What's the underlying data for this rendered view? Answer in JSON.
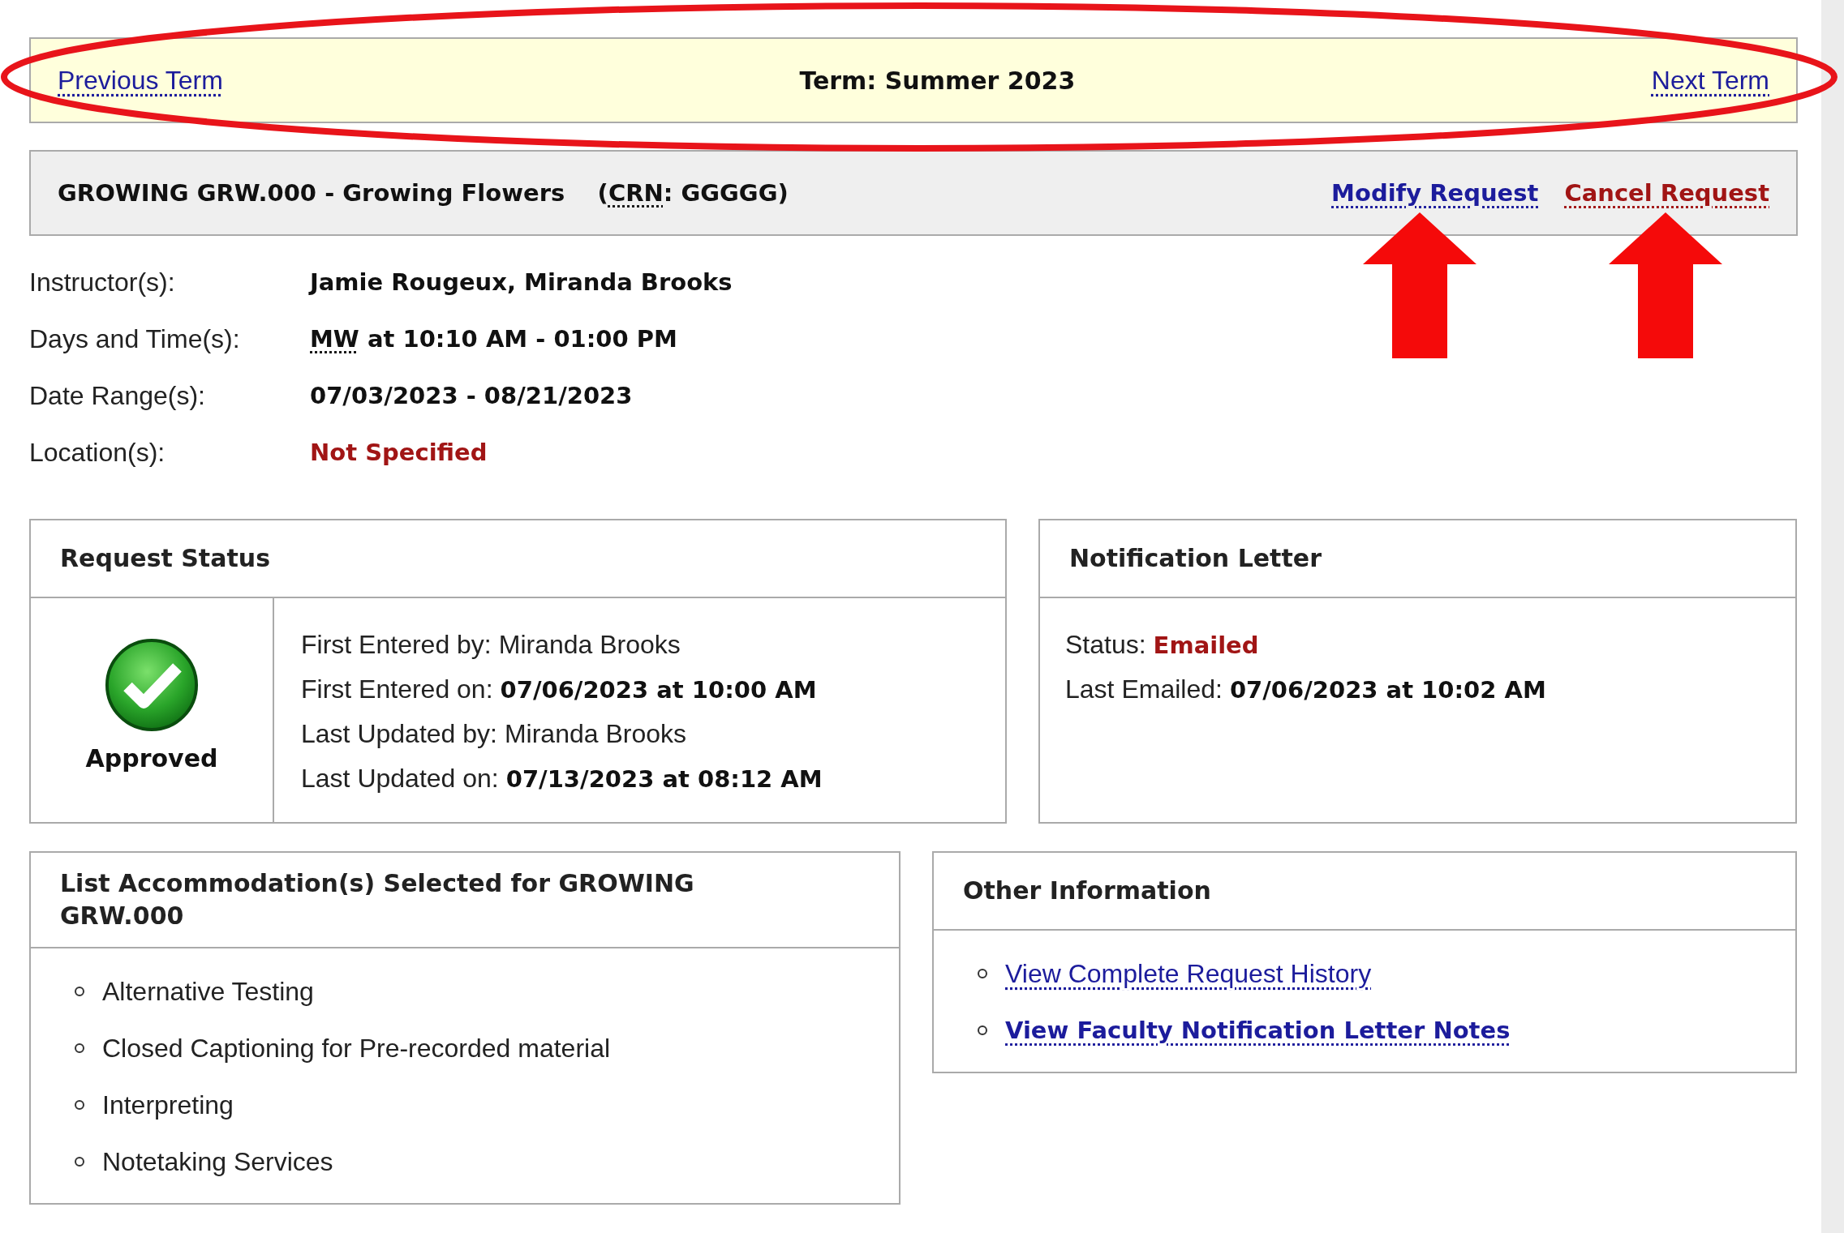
{
  "term_bar": {
    "previous": "Previous Term",
    "term": "Term: Summer 2023",
    "next": "Next Term"
  },
  "course": {
    "title": "GROWING GRW.000 - Growing Flowers",
    "crn_open": "(",
    "crn_abbr": "CRN",
    "crn_rest": ": GGGGG)",
    "actions": [
      {
        "label": "Modify Request",
        "kind": "modify"
      },
      {
        "label": "Cancel Request",
        "kind": "cancel"
      }
    ]
  },
  "details": [
    {
      "label": "Instructor(s):",
      "value": "Jamie Rougeux, Miranda Brooks",
      "alert": false
    },
    {
      "label": "Days and Time(s):",
      "abbr": "MW",
      "value": " at 10:10 AM - 01:00 PM",
      "alert": false
    },
    {
      "label": "Date Range(s):",
      "value": "07/03/2023 - 08/21/2023",
      "alert": false
    },
    {
      "label": "Location(s):",
      "value": "Not Specified",
      "alert": true
    }
  ],
  "request_status": {
    "title": "Request Status",
    "status": {
      "label": "Approved",
      "kind": "approved"
    },
    "lines": [
      {
        "label": "First Entered by:",
        "value": "Miranda Brooks",
        "kind": "plain"
      },
      {
        "label": "First Entered on:",
        "value": "07/06/2023 at 10:00 AM",
        "kind": "bold"
      },
      {
        "label": "Last Updated by:",
        "value": "Miranda Brooks",
        "kind": "plain"
      },
      {
        "label": "Last Updated on:",
        "value": "07/13/2023 at 08:12 AM",
        "kind": "bold"
      }
    ]
  },
  "notification_letter": {
    "title": "Notification Letter",
    "lines": [
      {
        "label": "Status:",
        "value": "Emailed",
        "kind": "alert"
      },
      {
        "label": "Last Emailed:",
        "value": "07/06/2023 at 10:02 AM",
        "kind": "bold"
      }
    ]
  },
  "accommodations": {
    "title": "List Accommodation(s) Selected for GROWING GRW.000",
    "items": [
      "Alternative Testing",
      "Closed Captioning for Pre-recorded material",
      "Interpreting",
      "Notetaking Services"
    ]
  },
  "other_information": {
    "title": "Other Information",
    "links": [
      {
        "label": "View Complete Request History",
        "bold": false
      },
      {
        "label": "View Faculty Notification Letter Notes",
        "bold": true
      }
    ]
  }
}
